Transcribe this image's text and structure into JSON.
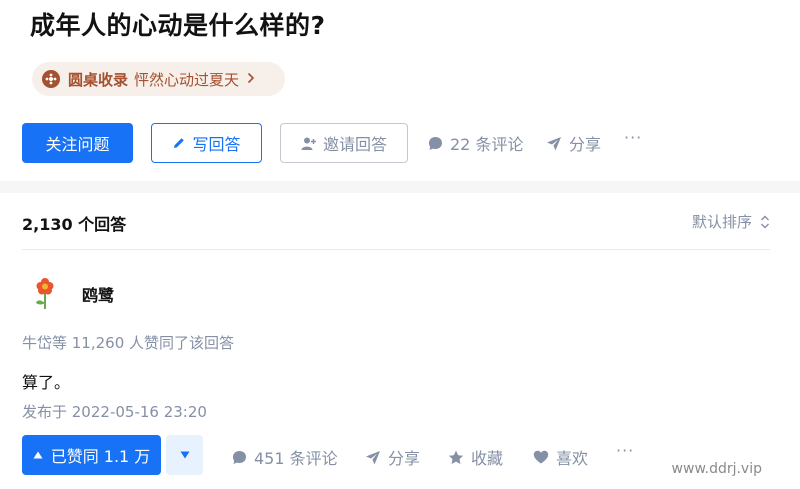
{
  "question": {
    "title": "成年人的心动是什么样的?",
    "roundtable": {
      "label": "圆桌收录",
      "name": "怦然心动过夏天"
    },
    "actions": {
      "follow": "关注问题",
      "write_answer": "写回答",
      "invite": "邀请回答",
      "comments": "22 条评论",
      "share": "分享",
      "more": "···"
    }
  },
  "answers": {
    "count": "2,130 个回答",
    "sort": "默认排序",
    "first": {
      "author": "鸥鹭",
      "likers": "牛岱等 11,260 人赞同了该回答",
      "content": "算了。",
      "date": "发布于 2022-05-16 23:20",
      "vote_up": "已赞同 1.1 万",
      "comments": "451 条评论",
      "share": "分享",
      "collect": "收藏",
      "like": "喜欢",
      "more": "···"
    }
  },
  "watermark": "www.ddrj.vip",
  "colors": {
    "primary": "#1772f6",
    "muted": "#8590a6",
    "roundtable": "#a5502f"
  },
  "icons": [
    "roundtable-icon",
    "pencil-icon",
    "invite-user-icon",
    "comment-icon",
    "share-icon",
    "sort-icon",
    "vote-up-icon",
    "vote-down-icon",
    "star-icon",
    "heart-icon"
  ]
}
